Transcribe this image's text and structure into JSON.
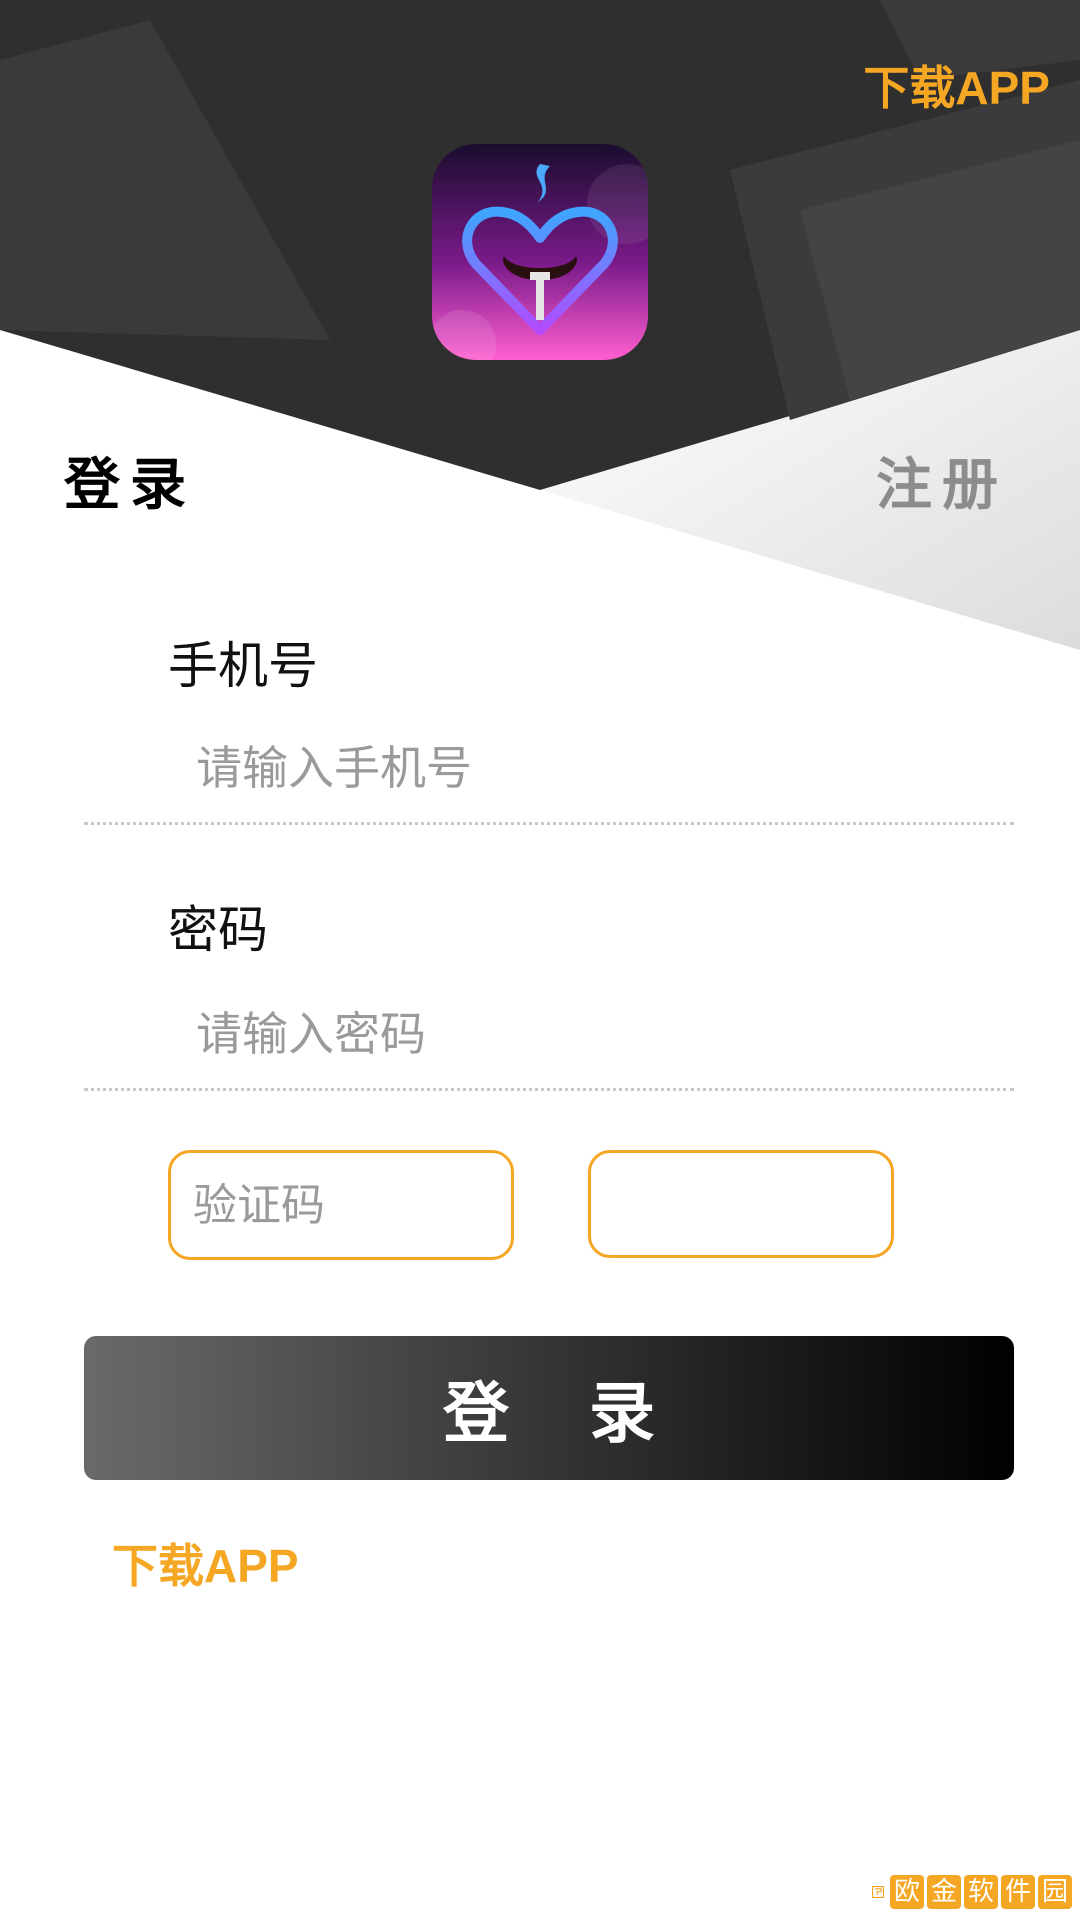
{
  "header": {
    "download_link": "下载APP"
  },
  "tabs": {
    "login": "登录",
    "register": "注册"
  },
  "form": {
    "phone_label": "手机号",
    "phone_placeholder": "请输入手机号",
    "password_label": "密码",
    "password_placeholder": "请输入密码",
    "captcha_placeholder": "验证码"
  },
  "actions": {
    "login_button": "登录",
    "download_link": "下载APP"
  },
  "watermark": {
    "text": "欧金软件园"
  },
  "colors": {
    "accent": "#F5A623",
    "header_dark": "#2d2d2d",
    "button_start": "#6a6a6a",
    "button_end": "#000000"
  },
  "icons": {
    "app_logo": "heart-sausage-logo-icon"
  }
}
